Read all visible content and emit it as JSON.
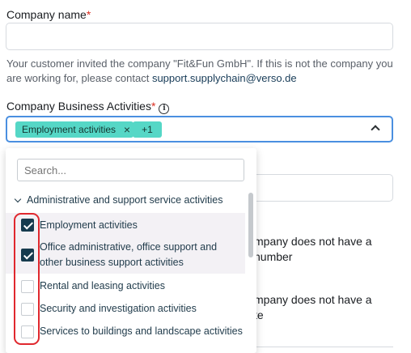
{
  "company_name": {
    "label": "Company name",
    "required_mark": "*",
    "value": ""
  },
  "note": {
    "text": "Your customer invited the company \"Fit&Fun GmbH\". If this is not the company you are working for, please contact",
    "link": "support.supplychain@verso.de"
  },
  "business": {
    "label": "Company Business Activities",
    "required_mark": "*",
    "info_icon": "info-icon",
    "chips": [
      {
        "label": "Employment activities",
        "remove_icon": "×"
      },
      {
        "label": "+1"
      }
    ]
  },
  "dropdown": {
    "search_placeholder": "Search...",
    "group": "Administrative and support service activities",
    "options": [
      {
        "label": "Employment activities",
        "checked": true
      },
      {
        "label_line1": "Office administrative, office support and",
        "label_line2": "other business support activities",
        "checked": true
      },
      {
        "label": "Rental and leasing activities",
        "checked": false
      },
      {
        "label": "Security and investigation activities",
        "checked": false
      },
      {
        "label": "Services to buildings and landscape activities",
        "checked": false
      }
    ]
  },
  "background": {
    "text1_line1": "mpany does not have a",
    "text1_line2": "number",
    "text2_line1": "mpany does not have a",
    "text2_line2": "te"
  },
  "colors": {
    "chip": "#55d7c6",
    "focus_border": "#4a8fe0",
    "checkbox_checked": "#163b4e",
    "annotation": "#e0282e"
  }
}
